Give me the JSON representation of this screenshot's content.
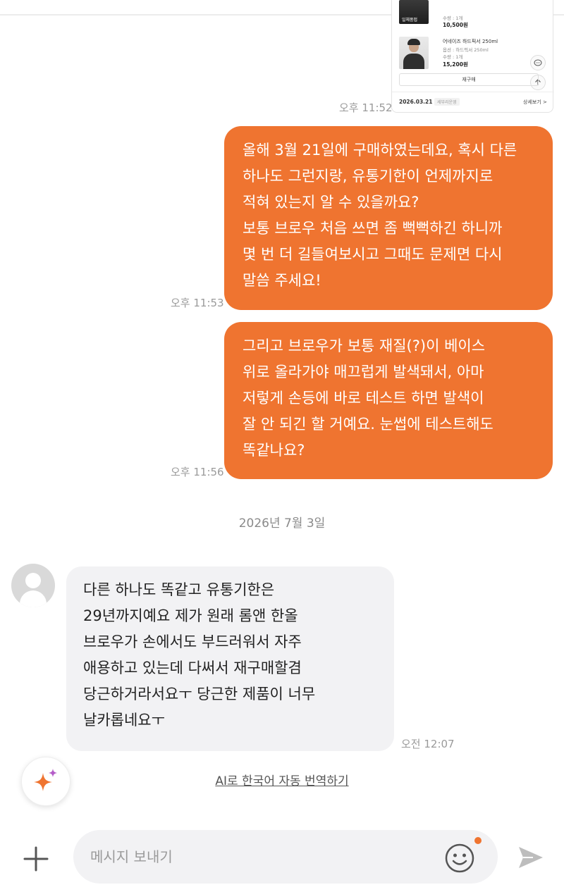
{
  "order_card": {
    "item1": {
      "thumb_label": "일체품펍",
      "qty": "수량 : 1개",
      "price": "10,500원"
    },
    "item2": {
      "name": "어네이즈 하드픽서 250ml",
      "option": "옵션 : 하드픽서 250ml",
      "qty": "수량 : 1개",
      "price": "15,200원"
    },
    "reorder_label": "재구매",
    "date": "2026.03.21",
    "badge": "세부리운영",
    "detail_label": "상세보기 >"
  },
  "messages": [
    {
      "direction": "outgoing",
      "time": "오후 11:52",
      "lines": []
    },
    {
      "direction": "outgoing",
      "time": "오후 11:53",
      "lines": [
        "올해 3월 21일에 구매하였는데요, 혹시 다른",
        "하나도 그런지랑, 유통기한이 언제까지로",
        "적혀 있는지 알 수 있을까요?",
        "보통 브로우 처음 쓰면 좀 뻑뻑하긴 하니까",
        "몇 번 더 길들여보시고 그때도 문제면 다시",
        "말씀 주세요!"
      ]
    },
    {
      "direction": "outgoing",
      "time": "오후 11:56",
      "lines": [
        "그리고 브로우가 보통 재질(?)이 베이스",
        "위로 올라가야 매끄럽게 발색돼서, 아마",
        "저렇게 손등에 바로 테스트 하면 발색이",
        "잘 안 되긴 할 거예요. 눈썹에 테스트해도",
        "똑같나요?"
      ]
    },
    {
      "direction": "incoming",
      "time": "오전 12:07",
      "lines": [
        "다른 하나도 똑같고 유통기한은",
        "29년까지예요 제가 원래 롬앤 한올",
        "브로우가 손에서도 부드러워서 자주",
        "애용하고 있는데 다써서 재구매할겸",
        "당근하거라서요ㅜ 당근한 제품이 너무",
        "날카롭네요ㅜ"
      ]
    }
  ],
  "date_separator": "2026년 7월 3일",
  "translate_link": "AI로 한국어 자동 번역하기",
  "composer": {
    "placeholder": "메시지 보내기"
  },
  "colors": {
    "accent": "#ef7430",
    "incoming_bubble": "#f2f2f4",
    "timestamp": "#9a9a9a"
  },
  "icons": [
    "plus-icon",
    "emoji-icon",
    "send-icon",
    "sparkle-icon",
    "avatar-icon",
    "chat-icon",
    "arrow-up-icon"
  ]
}
